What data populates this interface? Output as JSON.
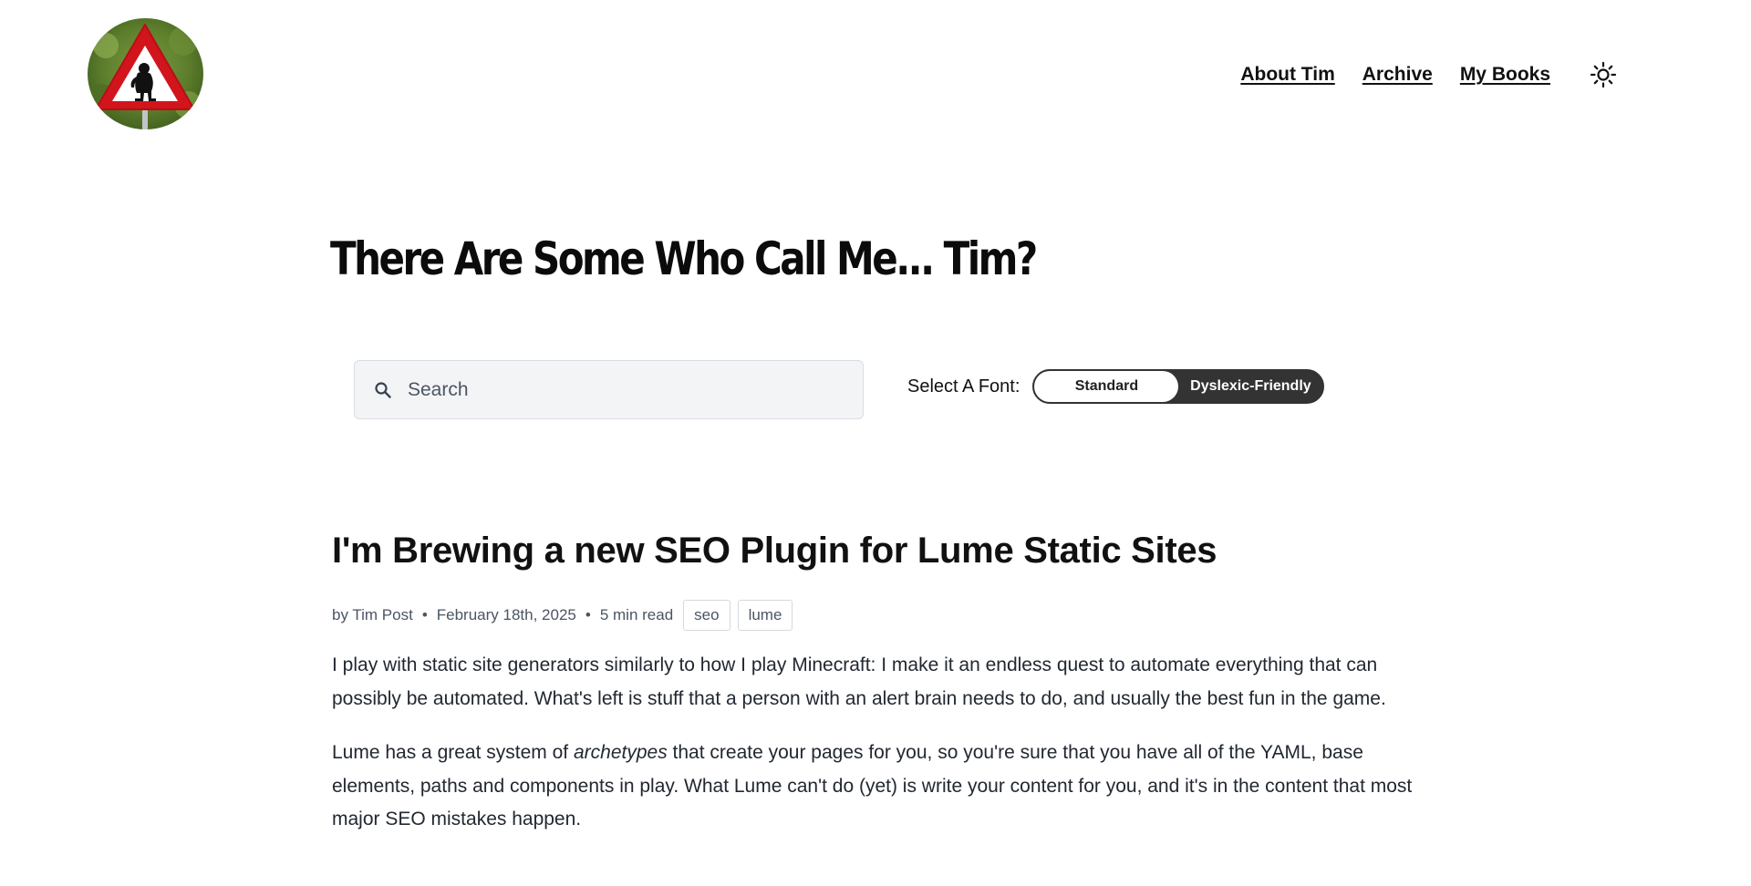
{
  "header": {
    "logo_alt": "Troll warning road sign",
    "nav": [
      {
        "label": "About Tim"
      },
      {
        "label": "Archive"
      },
      {
        "label": "My Books"
      }
    ],
    "theme_toggle_icon": "sun-icon"
  },
  "site_title": "There Are Some Who Call Me... Tim?",
  "search": {
    "placeholder": "Search",
    "value": "",
    "icon": "search-icon"
  },
  "font_select": {
    "label": "Select A Font:",
    "options": [
      "Standard",
      "Dyslexic-Friendly"
    ],
    "selected": "Standard"
  },
  "post": {
    "title": "I'm Brewing a new SEO Plugin for Lume Static Sites",
    "author": "by Tim Post",
    "bullet": "•",
    "date": "February 18th, 2025",
    "read_time": "5 min read",
    "tags": [
      "seo",
      "lume"
    ],
    "paragraph1": "I play with static site generators similarly to how I play Minecraft: I make it an endless quest to automate everything that can possibly be automated. What's left is stuff that a person with an alert brain needs to do, and usually the best fun in the game.",
    "paragraph2_before": "Lume has a great system of ",
    "paragraph2_em": "archetypes",
    "paragraph2_after": " that create your pages for you, so you're sure that you have all of the YAML, base elements, paths and components in play. What Lume can't do (yet) is write your content for you, and it's in the content that most major SEO mistakes happen."
  },
  "colors": {
    "text": "#1f2937",
    "title": "#0b0b0b",
    "meta": "#4b5563",
    "search_bg": "#f3f4f6",
    "toggle_dark": "#333333",
    "sign_red": "#d2141c"
  }
}
